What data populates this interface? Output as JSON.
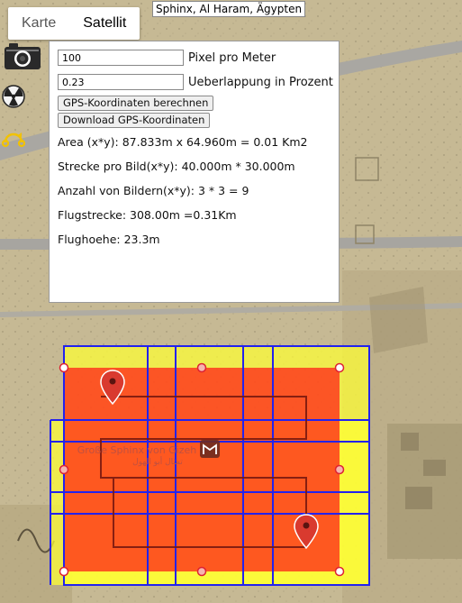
{
  "map_tabs": [
    {
      "label": "Karte",
      "active": false
    },
    {
      "label": "Satellit",
      "active": true
    }
  ],
  "place_label": "Sphinx, Al Haram, Ägypten",
  "map_poi_label": "Große Sphinx von Gizeh",
  "map_poi_label_arabic": "تمثال أبو الهول",
  "side_icons": [
    "camera-icon",
    "radiation-icon",
    "route-icon"
  ],
  "panel": {
    "pixel_value": "100",
    "pixel_label": "Pixel pro Meter",
    "overlap_value": "0.23",
    "overlap_label": "Ueberlappung in Prozent",
    "calc_button": "GPS-Koordinaten berechnen",
    "download_button": "Download GPS-Koordinaten",
    "area": "Area (x*y): 87.833m x 64.960m = 0.01 Km2",
    "strecke": "Strecke pro Bild(x*y): 40.000m * 30.000m",
    "anzahl": "Anzahl von Bildern(x*y): 3 * 3 = 9",
    "flugstrecke": "Flugstrecke: 308.00m =0.31Km",
    "flughoehe": "Flughoehe: 23.3m"
  },
  "colors": {
    "footprint_fill": "#ffff33",
    "area_fill": "#ff2a1a",
    "grid_stroke": "#2222ee",
    "route_stroke": "#7a1a10",
    "marker": "#d93a2f",
    "accent_yellow": "#f2c200"
  }
}
